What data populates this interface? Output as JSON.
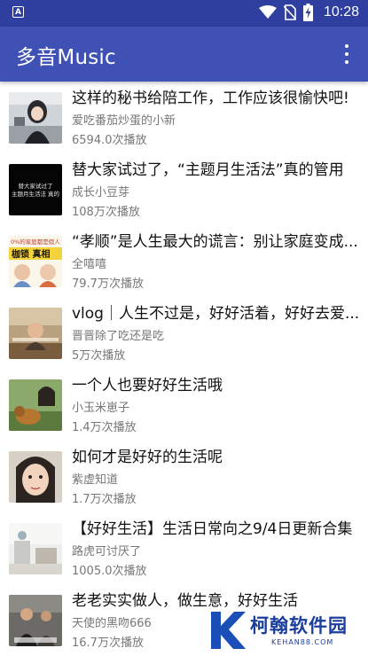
{
  "status_bar": {
    "time": "10:28",
    "notification_icon": "a-letter-icon"
  },
  "app_bar": {
    "title": "多音Music",
    "menu_icon": "more-vert-icon"
  },
  "items": [
    {
      "title": "这样的秘书给陪工作，工作应该很愉快吧!",
      "author": "爱吃番茄炒蛋的小新",
      "plays": "6594.0次播放",
      "thumb_caption": ""
    },
    {
      "title": "替大家试过了，“主题月生活法”真的管用",
      "author": "成长小豆芽",
      "plays": "108万次播放",
      "thumb_caption": "替大家试过了 主题月生活法 真的管"
    },
    {
      "title": "“孝顺”是人生最大的谎言：别让家庭变成...",
      "author": "全嘻嘻",
      "plays": "79.7万次播放",
      "thumb_caption": "0%的家庭都是假人 枷锁 真相"
    },
    {
      "title": "vlog｜人生不过是，好好活着，好好去爱...",
      "author": "晋晋除了吃还是吃",
      "plays": "5万次播放",
      "thumb_caption": ""
    },
    {
      "title": "一个人也要好好生活哦",
      "author": "小玉米崽子",
      "plays": "1.4万次播放",
      "thumb_caption": ""
    },
    {
      "title": "如何才是好好的生活呢",
      "author": "紫虚知道",
      "plays": "1.7万次播放",
      "thumb_caption": ""
    },
    {
      "title": "【好好生活】生活日常向之9/4日更新合集",
      "author": "路虎可讨厌了",
      "plays": "1005.0次播放",
      "thumb_caption": ""
    },
    {
      "title": "老老实实做人，做生意，好好生活",
      "author": "天使的黑吻666",
      "plays": "16.7万次播放",
      "thumb_caption": ""
    }
  ],
  "watermark": {
    "text": "柯翰软件园",
    "sub": "KEHAN88.COM"
  }
}
